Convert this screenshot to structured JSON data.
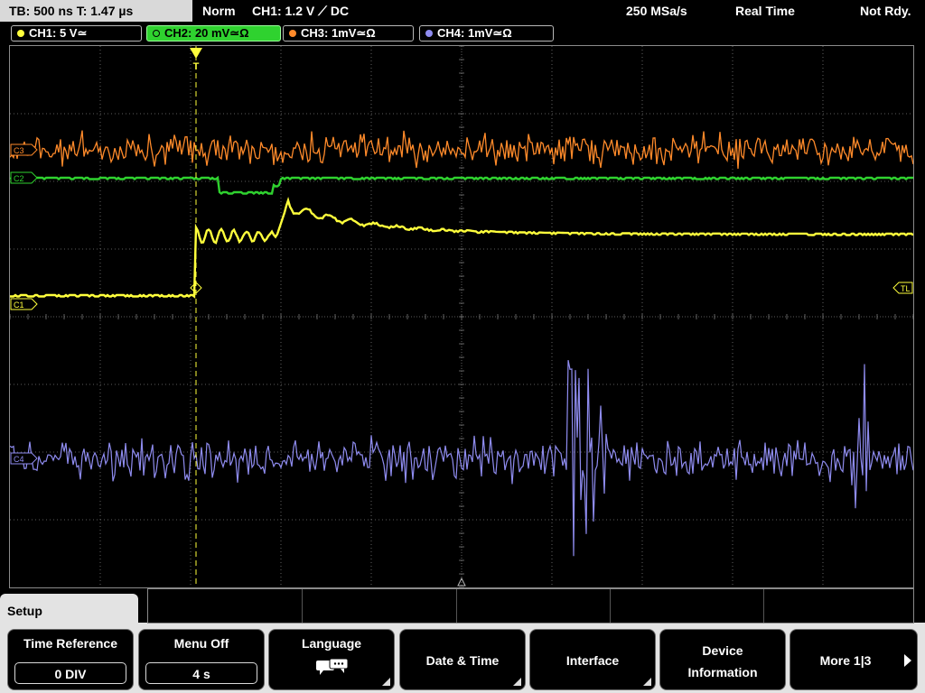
{
  "topbar": {
    "timebase": "TB: 500 ns  T: 1.47 µs",
    "mode": "Norm",
    "trigger": "CH1: 1.2 V ⟋ DC",
    "sample_rate": "250 MSa/s",
    "acq": "Real Time",
    "status": "Not Rdy."
  },
  "channels": [
    {
      "label": "CH1: 5 V≃",
      "color": "#ffff3c"
    },
    {
      "label": "CH2: 20 mV≃Ω",
      "color": "#2fd22f"
    },
    {
      "label": "CH3: 1mV≃Ω",
      "color": "#ff8a2a"
    },
    {
      "label": "CH4: 1mV≃Ω",
      "color": "#8f8cf0"
    }
  ],
  "markers": {
    "ch1": "C1",
    "ch2": "C2",
    "ch3": "C3",
    "ch4": "C4",
    "trigger_level": "TL",
    "trigger_t": "T"
  },
  "waveform_colors": {
    "ch1": "#ffff3c",
    "ch2": "#2fd22f",
    "ch3": "#ff8a2a",
    "ch4": "#8f8cf0",
    "grid": "#7a7a7a"
  },
  "menu": {
    "title": "Setup",
    "softkeys": [
      {
        "label": "Time Reference",
        "value": "0 DIV"
      },
      {
        "label": "Menu Off",
        "value": "4 s"
      },
      {
        "label": "Language",
        "icon": "speech-bubble-icon"
      },
      {
        "label": "Date & Time"
      },
      {
        "label": "Interface"
      },
      {
        "label1": "Device",
        "label2": "Information"
      },
      {
        "label": "More 1|3"
      }
    ]
  }
}
